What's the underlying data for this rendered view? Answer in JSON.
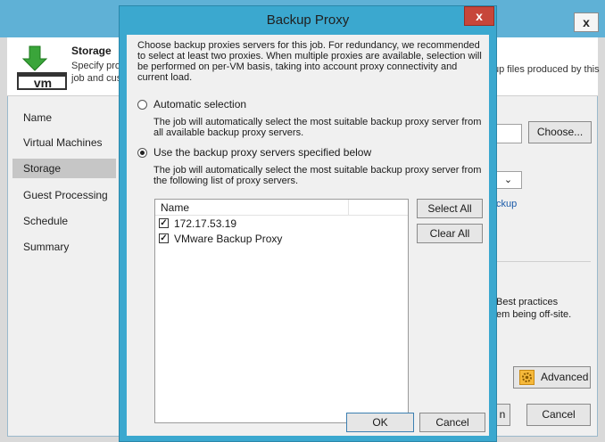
{
  "background_window": {
    "close_glyph": "x",
    "header": {
      "title": "Storage",
      "description_line1": "Specify pro",
      "description_line2": "job and cus",
      "description_right": "up files produced by this",
      "icon": "vm-storage-download-icon",
      "icon_text": "vm"
    },
    "nav": [
      {
        "label": "Name",
        "selected": false
      },
      {
        "label": "Virtual Machines",
        "selected": false
      },
      {
        "label": "Storage",
        "selected": true
      },
      {
        "label": "Guest Processing",
        "selected": false
      },
      {
        "label": "Schedule",
        "selected": false
      },
      {
        "label": "Summary",
        "selected": false
      }
    ],
    "choose_label": "Choose...",
    "combo_arrow": "⌄",
    "link_partial": "ckup",
    "best_practices_line1": "Best practices",
    "best_practices_line2": "em being off-site.",
    "advanced_label": "Advanced",
    "partial_button_label": "n",
    "cancel_label": "Cancel"
  },
  "dialog": {
    "title": "Backup Proxy",
    "close_glyph": "x",
    "intro": "Choose backup proxies servers for this job. For redundancy, we recommended to select at least two proxies. When multiple proxies are available, selection will be performed on per-VM basis, taking into account proxy connectivity and current load.",
    "automatic": {
      "label": "Automatic selection",
      "description": "The job will automatically select the most suitable backup proxy server from all available backup proxy servers.",
      "checked": false
    },
    "specified": {
      "label": "Use the backup proxy servers specified below",
      "description": "The job will automatically select the most suitable backup proxy server from the following list of proxy servers.",
      "checked": true
    },
    "list": {
      "column_name": "Name",
      "items": [
        {
          "label": "172.17.53.19",
          "checked": true
        },
        {
          "label": "VMware Backup Proxy",
          "checked": true
        }
      ],
      "check_glyph": "✓"
    },
    "select_all_label": "Select All",
    "clear_all_label": "Clear All",
    "ok_label": "OK",
    "cancel_label": "Cancel"
  },
  "colors": {
    "dialog_frame": "#3ba8cf",
    "background_titlebar": "#5fb1d6",
    "close_button": "#c7463a",
    "link": "#1a5aa8"
  }
}
